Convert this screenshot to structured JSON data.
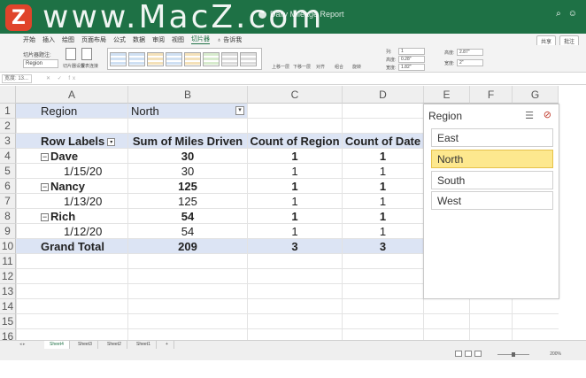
{
  "watermark": {
    "logo": "Z",
    "text": "www.MacZ.com"
  },
  "window": {
    "title": "Daily Mileage Report"
  },
  "ribbon_tabs": [
    "开始",
    "插入",
    "绘图",
    "页面布局",
    "公式",
    "数据",
    "审阅",
    "视图",
    "切片器",
    "告诉我"
  ],
  "share_buttons": {
    "share": "共享",
    "comment": "批注"
  },
  "ribbon": {
    "caption_label": "切片器题注:",
    "caption_value": "Region",
    "settings_label": "切片器设置",
    "report_label": "报表连接",
    "columns_label": "列:",
    "columns_value": "1",
    "height_label": "高度:",
    "height_value": "0.28\"",
    "width_label": "宽度:",
    "width_value": "1.82\"",
    "size_height_label": "高度:",
    "size_height_value": "2.87\"",
    "size_width_label": "宽度:",
    "size_width_value": "2\"",
    "bring_forward": "上移一层",
    "send_backward": "下移一层",
    "align": "对齐",
    "group": "组合",
    "rotate": "旋转"
  },
  "formula_bar": {
    "name_box": "宽度: 13...",
    "fx": "fx"
  },
  "columns": [
    "A",
    "B",
    "C",
    "D",
    "E",
    "F",
    "G"
  ],
  "rows": [
    "1",
    "2",
    "3",
    "4",
    "5",
    "6",
    "7",
    "8",
    "9",
    "10",
    "11",
    "12",
    "13",
    "14",
    "15",
    "16"
  ],
  "pivot": {
    "filter_label": "Region",
    "filter_value": "North",
    "headers": [
      "Row Labels",
      "Sum of Miles Driven",
      "Count of Region",
      "Count of Date"
    ],
    "body": [
      {
        "label": "Dave",
        "miles": "30",
        "region": "1",
        "date": "1",
        "level": "group"
      },
      {
        "label": "1/15/20",
        "miles": "30",
        "region": "1",
        "date": "1",
        "level": "item"
      },
      {
        "label": "Nancy",
        "miles": "125",
        "region": "1",
        "date": "1",
        "level": "group"
      },
      {
        "label": "1/13/20",
        "miles": "125",
        "region": "1",
        "date": "1",
        "level": "item"
      },
      {
        "label": "Rich",
        "miles": "54",
        "region": "1",
        "date": "1",
        "level": "group"
      },
      {
        "label": "1/12/20",
        "miles": "54",
        "region": "1",
        "date": "1",
        "level": "item"
      }
    ],
    "total": {
      "label": "Grand Total",
      "miles": "209",
      "region": "3",
      "date": "3"
    },
    "collapse_symbol": "⊟"
  },
  "slicer": {
    "title": "Region",
    "items": [
      {
        "label": "East",
        "selected": false
      },
      {
        "label": "North",
        "selected": true
      },
      {
        "label": "South",
        "selected": false
      },
      {
        "label": "West",
        "selected": false
      }
    ]
  },
  "sheets": [
    {
      "name": "Sheet4",
      "active": true
    },
    {
      "name": "Sheet3",
      "active": false
    },
    {
      "name": "Sheet2",
      "active": false
    },
    {
      "name": "Sheet1",
      "active": false
    }
  ],
  "status": {
    "zoom": "200%"
  },
  "colors": {
    "title_bar": "#1e7145",
    "pivot_header": "#dce4f4",
    "slicer_selected": "#fde88e"
  }
}
